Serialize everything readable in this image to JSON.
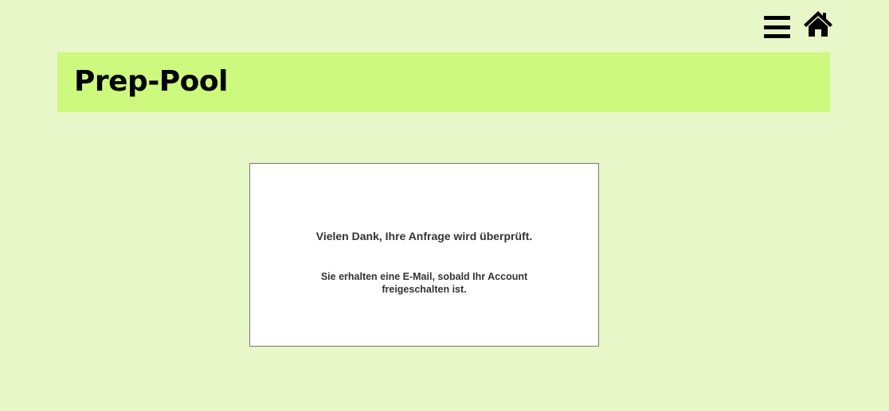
{
  "header": {
    "title": "Prep-Pool",
    "menu_icon": "hamburger-menu-icon",
    "home_icon": "home-icon"
  },
  "message": {
    "headline": "Vielen Dank, Ihre Anfrage wird überprüft.",
    "detail": "Sie erhalten eine E-Mail, sobald Ihr Account freigeschalten ist."
  },
  "colors": {
    "page_background": "#e8f7c8",
    "header_band": "#cdf97e",
    "box_background": "#ffffff",
    "box_border": "#777777",
    "text": "#333333"
  }
}
